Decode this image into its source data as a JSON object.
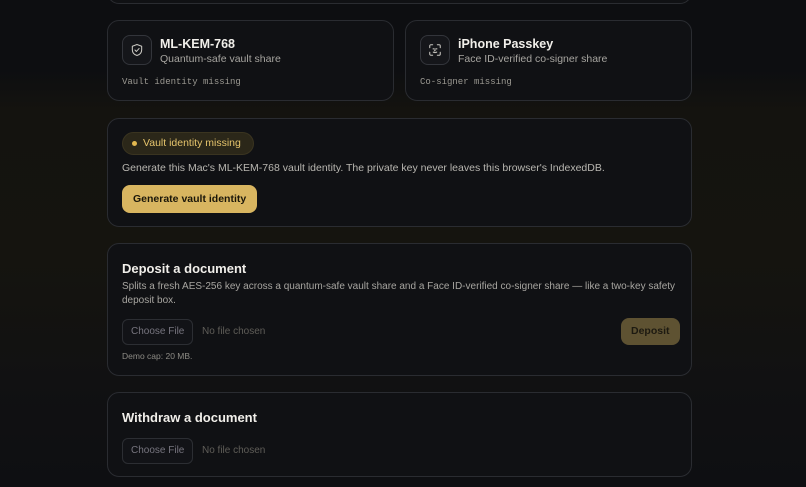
{
  "shares": [
    {
      "icon": "shield-icon",
      "title": "ML-KEM-768",
      "subtitle": "Quantum-safe vault share",
      "status": "Vault identity missing"
    },
    {
      "icon": "face-id-icon",
      "title": "iPhone Passkey",
      "subtitle": "Face ID-verified co-signer share",
      "status": "Co-signer missing"
    }
  ],
  "identity": {
    "badge": "Vault identity missing",
    "description": "Generate this Mac's ML-KEM-768 vault identity. The private key never leaves this browser's IndexedDB.",
    "button": "Generate vault identity"
  },
  "deposit": {
    "title": "Deposit a document",
    "description": "Splits a fresh AES-256 key across a quantum-safe vault share and a Face ID-verified co-signer share — like a two-key safety deposit box.",
    "file_button": "Choose File",
    "file_status": "No file chosen",
    "submit": "Deposit",
    "cap": "Demo cap: 20 MB."
  },
  "withdraw": {
    "title": "Withdraw a document",
    "file_button": "Choose File",
    "file_status": "No file chosen"
  },
  "colors": {
    "accent_gold": "#d8b560",
    "badge_text": "#e6c46c",
    "deposit_disabled": "#5e5232"
  }
}
